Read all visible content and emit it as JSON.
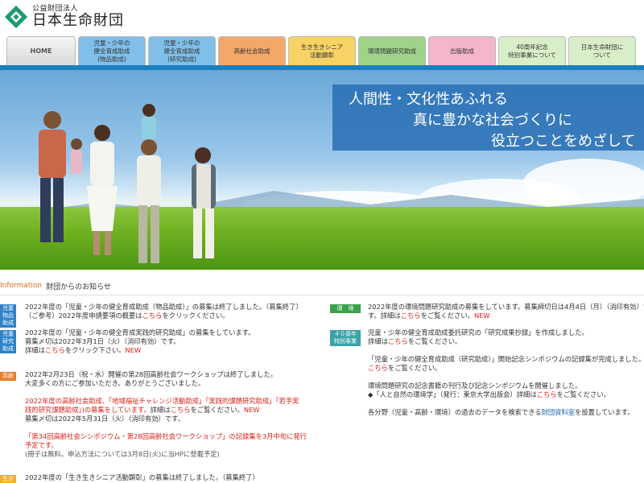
{
  "header": {
    "org_type": "公益財団法人",
    "org_name": "日本生命財団"
  },
  "nav": [
    {
      "label": "HOME",
      "color": "#d9d9d9"
    },
    {
      "label": "児童・少年の\n健全育成助成\n(物品助成)",
      "color": "#7fbfea"
    },
    {
      "label": "児童・少年の\n健全育成助成\n(研究助成)",
      "color": "#7fbfea"
    },
    {
      "label": "高齢社会助成",
      "color": "#f3a86a"
    },
    {
      "label": "生き生きシニア\n活動顕彰",
      "color": "#f7d264"
    },
    {
      "label": "環境問題研究助成",
      "color": "#9fd28a"
    },
    {
      "label": "出版助成",
      "color": "#f4b6c8"
    },
    {
      "label": "40周年記念\n特別事業について",
      "color": "#d8eec8"
    },
    {
      "label": "日本生命財団に\nついて",
      "color": "#d8eec8"
    }
  ],
  "hero": {
    "line1": "人間性・文化性あふれる",
    "line2": "真に豊かな社会づくりに",
    "line3": "役立つことをめざして"
  },
  "info": {
    "title_en": "Information",
    "title_jp": "財団からのお知らせ"
  },
  "news_left": [
    {
      "badge": "児童\n物品助成",
      "badge_color": "#2e82c8",
      "lines": [
        [
          {
            "t": "2022年度の「児童・少年の健全育成助成（物品助成）」の募集は終了しました。（募集終了）"
          }
        ],
        [
          {
            "t": "（ご参考）2022年度申請要項の概要は"
          },
          {
            "t": "こちら",
            "c": "red"
          },
          {
            "t": "をクリックください。"
          }
        ]
      ]
    },
    {
      "badge": "児童\n研究助成",
      "badge_color": "#2e82c8",
      "lines": [
        [
          {
            "t": "2022年度の「児童・少年の健全育成実践的研究助成」の募集をしています。"
          }
        ],
        [
          {
            "t": "募集〆切は2022年3月1日（火）（消印有効）です。"
          }
        ],
        [
          {
            "t": "詳細は"
          },
          {
            "t": "こちら",
            "c": "red"
          },
          {
            "t": "をクリック下さい。"
          },
          {
            "t": "NEW",
            "c": "red"
          }
        ]
      ]
    },
    {
      "badge": "高齢",
      "badge_color": "#e87d2a",
      "lines": [
        [
          {
            "t": "2022年2月23日（祝・水）開催の第28回高齢社会ワークショップは終了しました。"
          }
        ],
        [
          {
            "t": "大変多くの方にご参加いただき、ありがとうございました。"
          }
        ],
        [
          {
            "t": ""
          }
        ],
        [
          {
            "t": "2022年度の高齢社会助成、「地域福祉チャレンジ活動助成」「実践的課題研究助成」「若手実",
            "c": "red"
          }
        ],
        [
          {
            "t": "践的研究課題助成」)の募集をしています。",
            "c": "red"
          },
          {
            "t": "詳細は"
          },
          {
            "t": "こちら",
            "c": "red"
          },
          {
            "t": "をご覧ください。"
          },
          {
            "t": "NEW",
            "c": "red"
          }
        ],
        [
          {
            "t": "募集〆切は2022年5月31日（火）（消印有効）です。"
          }
        ],
        [
          {
            "t": ""
          }
        ],
        [
          {
            "t": "「第34回高齢社会シンポジウム・第28回高齢社会ワークショップ」の記録集を3月中旬に発行",
            "c": "red"
          }
        ],
        [
          {
            "t": "予定です。",
            "c": "red"
          }
        ],
        [
          {
            "t": "(冊子は無料。申込方法については3月8日(火)に当HPに登載予定)",
            "c": "gray"
          }
        ]
      ]
    },
    {
      "badge": "生き生き",
      "badge_color": "#f2b21a",
      "lines": [
        [
          {
            "t": "2022年度の「生き生きシニア活動顕彰」の募集は終了しました。（募集終了）"
          }
        ]
      ]
    }
  ],
  "news_right": [
    {
      "badge": "環　境",
      "badge_color": "#3aa24a",
      "lines": [
        [
          {
            "t": "2022年度の環境問題研究助成の募集をしています。募集締切日は4月4日（月）（消印有効）で"
          }
        ],
        [
          {
            "t": "す。詳細は"
          },
          {
            "t": "こちら",
            "c": "red"
          },
          {
            "t": "をご覧ください。"
          },
          {
            "t": "NEW",
            "c": "red"
          }
        ]
      ]
    },
    {
      "badge": "４０周年\n特別事業",
      "badge_color": "#3aa2a8",
      "lines": [
        [
          {
            "t": "児童・少年の健全育成助成委託研究の「研究成果抄録」を作成しました。"
          }
        ],
        [
          {
            "t": "詳細は"
          },
          {
            "t": "こちら",
            "c": "red"
          },
          {
            "t": "をご覧ください。"
          }
        ],
        [
          {
            "t": ""
          }
        ],
        [
          {
            "t": "「児童・少年の健全育成助成（研究助成）」開始記念シンポジウムの記録集が完成しました。"
          }
        ],
        [
          {
            "t": "こちら",
            "c": "red"
          },
          {
            "t": "をご覧ください。"
          }
        ],
        [
          {
            "t": ""
          }
        ],
        [
          {
            "t": "環境問題研究の記念書籍の刊行及び記念シンポジウムを開催しました。"
          }
        ],
        [
          {
            "t": "◆「人と自然の環境学」（発行：東京大学出版会）詳細は"
          },
          {
            "t": "こちら",
            "c": "red"
          },
          {
            "t": "をご覧ください。"
          }
        ],
        [
          {
            "t": ""
          }
        ],
        [
          {
            "t": "各分野（児童・高齢・環境）の過去のデータを検索できる"
          },
          {
            "t": "財団資料室",
            "c": "blue"
          },
          {
            "t": "を設置しています。"
          }
        ]
      ]
    }
  ]
}
